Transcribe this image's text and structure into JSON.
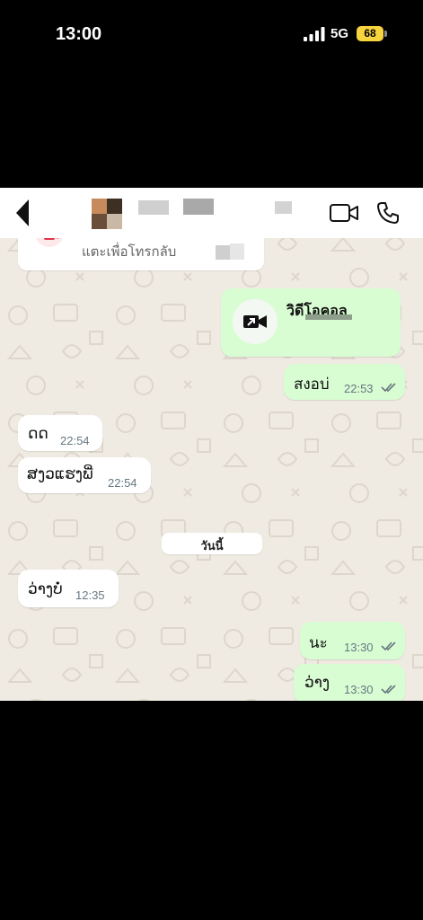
{
  "status_bar": {
    "time": "13:00",
    "network": "5G",
    "battery": "68",
    "battery_color": "#f7d33d"
  },
  "header": {
    "back_icon": "chevron-left-icon",
    "video_call_icon": "video-camera-icon",
    "voice_call_icon": "phone-icon"
  },
  "missed_call_card": {
    "text": "แตะเพื่อโทรกลับ",
    "icon": "missed-video-call-icon"
  },
  "video_call_message": {
    "title": "วิดีโอคอล",
    "icon": "outgoing-video-call-icon"
  },
  "messages": [
    {
      "direction": "out",
      "text": "สงอบ่",
      "time": "22:53",
      "read": true
    },
    {
      "direction": "in",
      "text": "ດດ",
      "time": "22:54"
    },
    {
      "direction": "in",
      "text": "ສງວແຮງພີ່",
      "time": "22:54"
    },
    {
      "direction": "in",
      "text": "ວ່າງບໍ່",
      "time": "12:35"
    },
    {
      "direction": "out",
      "text": "นะ",
      "time": "13:30",
      "read": true
    },
    {
      "direction": "out",
      "text": "ວ່າງ",
      "time": "13:30",
      "read": true
    }
  ],
  "date_divider": "วันนี้",
  "colors": {
    "outgoing_bubble": "#d9fdd3",
    "incoming_bubble": "#ffffff",
    "chat_background": "#efeae2",
    "read_ticks": "#667781"
  }
}
